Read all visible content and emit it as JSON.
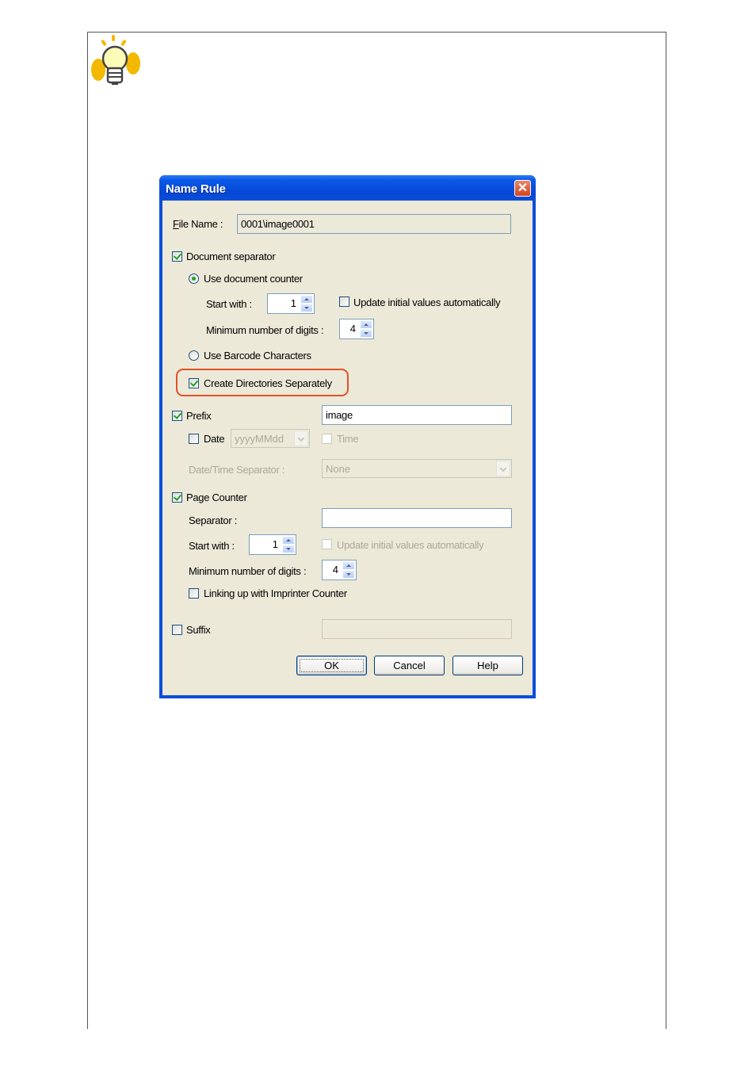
{
  "page": {
    "hint_icon": "lightbulb-hint-icon"
  },
  "dialog": {
    "title": "Name Rule",
    "close_icon": "close-icon",
    "file_name": {
      "label": "File Name :",
      "value": "0001\\image0001"
    },
    "document_separator": {
      "label": "Document separator",
      "checked": true,
      "use_document_counter": {
        "label": "Use document counter",
        "selected": true
      },
      "start_with": {
        "label": "Start with :",
        "value": "1"
      },
      "update_initial": {
        "label": "Update initial values automatically",
        "checked": false
      },
      "min_digits": {
        "label": "Minimum number of digits :",
        "value": "4"
      },
      "use_barcode": {
        "label": "Use Barcode Characters",
        "selected": false
      },
      "create_directories": {
        "label": "Create Directories Separately",
        "checked": true,
        "highlighted": true
      }
    },
    "prefix": {
      "label": "Prefix",
      "checked": true,
      "value": "image",
      "date": {
        "label": "Date",
        "checked": false,
        "format": "yyyyMMdd"
      },
      "time": {
        "label": "Time",
        "checked": false,
        "disabled": true
      },
      "date_time_separator": {
        "label": "Date/Time Separator :",
        "value": "None",
        "disabled": true
      }
    },
    "page_counter": {
      "label": "Page Counter",
      "checked": true,
      "separator": {
        "label": "Separator :",
        "value": ""
      },
      "start_with": {
        "label": "Start with :",
        "value": "1"
      },
      "update_initial": {
        "label": "Update initial values automatically",
        "checked": false,
        "disabled": true
      },
      "min_digits": {
        "label": "Minimum number of digits :",
        "value": "4"
      },
      "linking_imprinter": {
        "label": "Linking up with Imprinter Counter",
        "checked": false
      }
    },
    "suffix": {
      "label": "Suffix",
      "checked": false,
      "value": ""
    },
    "buttons": {
      "ok": "OK",
      "cancel": "Cancel",
      "help": "Help"
    },
    "colors": {
      "titlebar": "#0a4fdc",
      "body": "#ece9d8",
      "highlight": "#e0522a",
      "check": "#21a121"
    }
  }
}
